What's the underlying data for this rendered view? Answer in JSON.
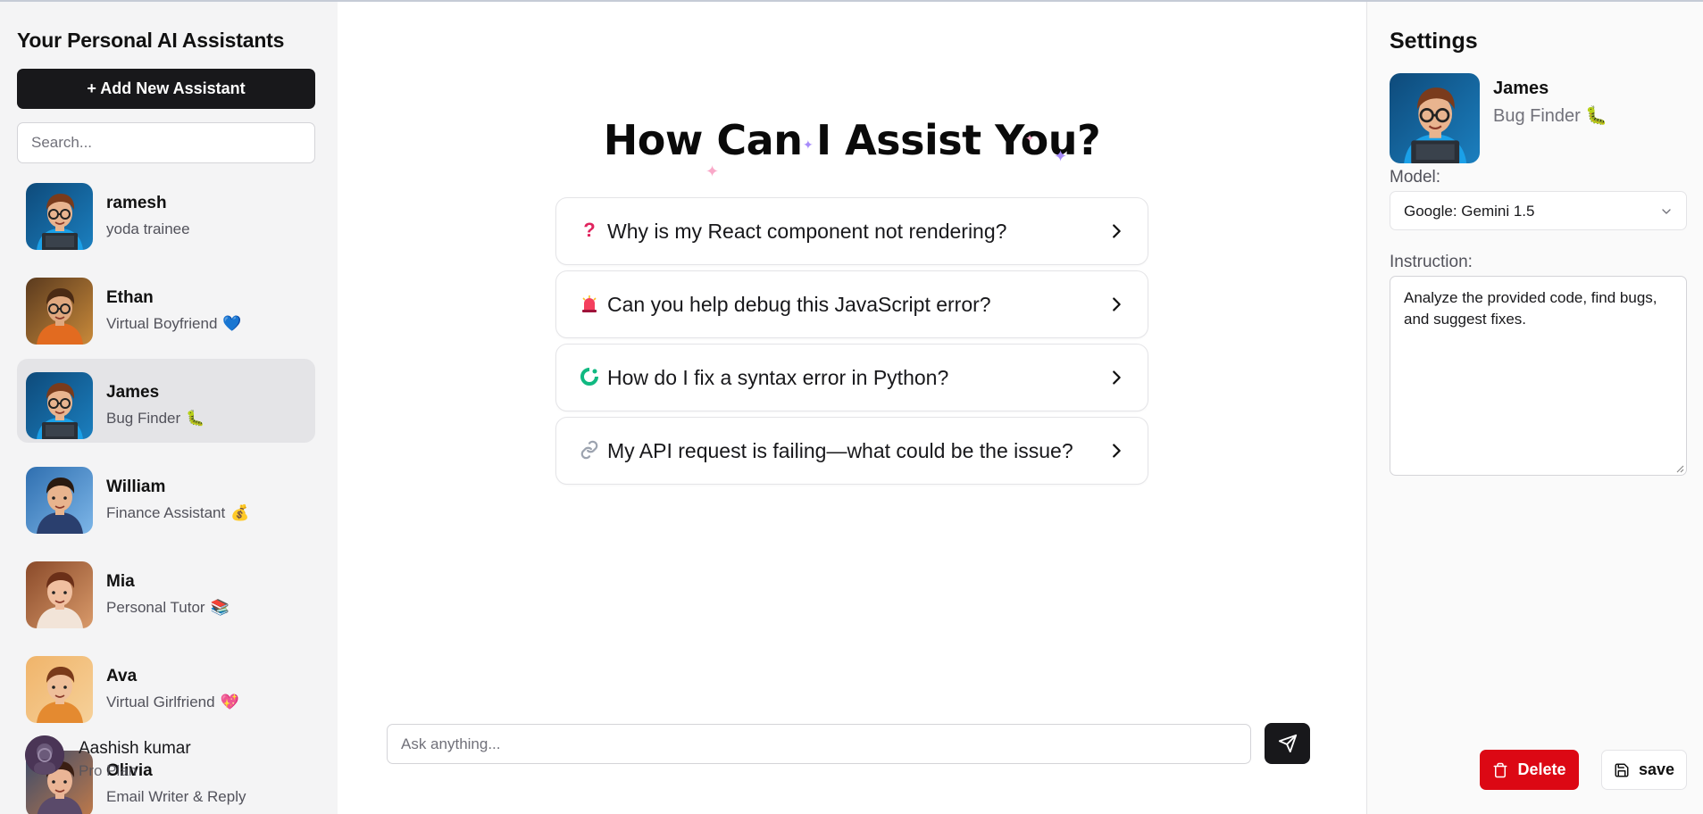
{
  "sidebar": {
    "title": "Your Personal AI Assistants",
    "add_label": "+ Add New Assistant",
    "search_placeholder": "Search...",
    "assistants": [
      {
        "name": "ramesh",
        "role": "yoda trainee",
        "emoji": "",
        "avatar": "boy-laptop-blue"
      },
      {
        "name": "Ethan",
        "role": "Virtual Boyfriend",
        "emoji": "💙",
        "avatar": "man-orange-scarf"
      },
      {
        "name": "James",
        "role": "Bug Finder",
        "emoji": "🐛",
        "avatar": "boy-laptop-blue"
      },
      {
        "name": "William",
        "role": "Finance Assistant",
        "emoji": "💰",
        "avatar": "man-suit"
      },
      {
        "name": "Mia",
        "role": "Personal Tutor",
        "emoji": "📚",
        "avatar": "woman-books"
      },
      {
        "name": "Ava",
        "role": "Virtual Girlfriend",
        "emoji": "💖",
        "avatar": "woman-selfie"
      },
      {
        "name": "Olivia",
        "role": "Email Writer & Reply",
        "emoji": "",
        "avatar": "woman-city"
      }
    ],
    "profile": {
      "name": "Aashish kumar",
      "plan": "Pro Plan"
    }
  },
  "main": {
    "heading": "How Can I Assist You?",
    "suggestions": [
      {
        "icon": "question-icon",
        "text": "Why is my React component not rendering?"
      },
      {
        "icon": "siren-icon",
        "text": "Can you help debug this JavaScript error?"
      },
      {
        "icon": "python-icon",
        "text": "How do I fix a syntax error in Python?"
      },
      {
        "icon": "link-icon",
        "text": "My API request is failing—what could be the issue?"
      }
    ],
    "ask_placeholder": "Ask anything..."
  },
  "settings": {
    "title": "Settings",
    "name": "James",
    "role": "Bug Finder",
    "role_emoji": "🐛",
    "model_label": "Model:",
    "model_value": "Google: Gemini 1.5",
    "instruction_label": "Instruction:",
    "instruction_value": "Analyze the provided code, find bugs, and suggest fixes.",
    "delete_label": "Delete",
    "save_label": "save"
  },
  "colors": {
    "accent_dark": "#18181b",
    "danger": "#dc0814",
    "sidebar_bg": "#f4f4f5",
    "active_item": "#e4e4e7"
  }
}
